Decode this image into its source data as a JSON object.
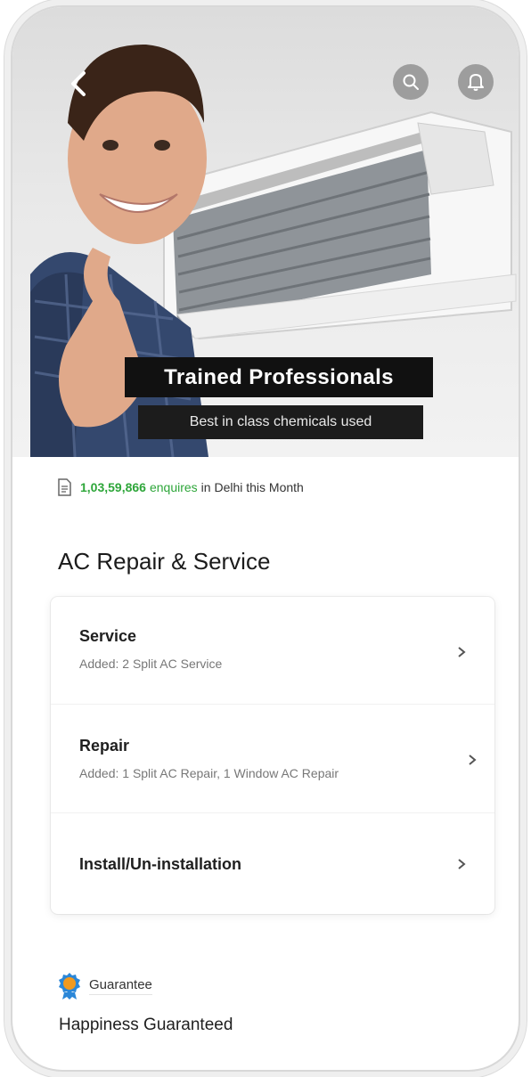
{
  "hero": {
    "caption_title": "Trained Professionals",
    "caption_subtitle": "Best in class chemicals used",
    "icons": {
      "back": "back-arrow-icon",
      "search": "search-icon",
      "notifications": "bell-icon"
    }
  },
  "enquiry": {
    "count": "1,03,59,866",
    "word": "enquires",
    "rest": "in Delhi this Month"
  },
  "page_title": "AC Repair & Service",
  "options": [
    {
      "label": "Service",
      "sub": "Added: 2 Split AC Service"
    },
    {
      "label": "Repair",
      "sub": "Added: 1 Split AC Repair, 1 Window AC Repair"
    },
    {
      "label": "Install/Un-installation",
      "sub": ""
    }
  ],
  "guarantee": {
    "label": "Guarantee",
    "headline": "Happiness Guaranteed"
  },
  "colors": {
    "accent_green": "#2ea63a",
    "caption_bg": "#111111",
    "badge_blue": "#2b87d8",
    "badge_orange": "#f29a1f"
  }
}
